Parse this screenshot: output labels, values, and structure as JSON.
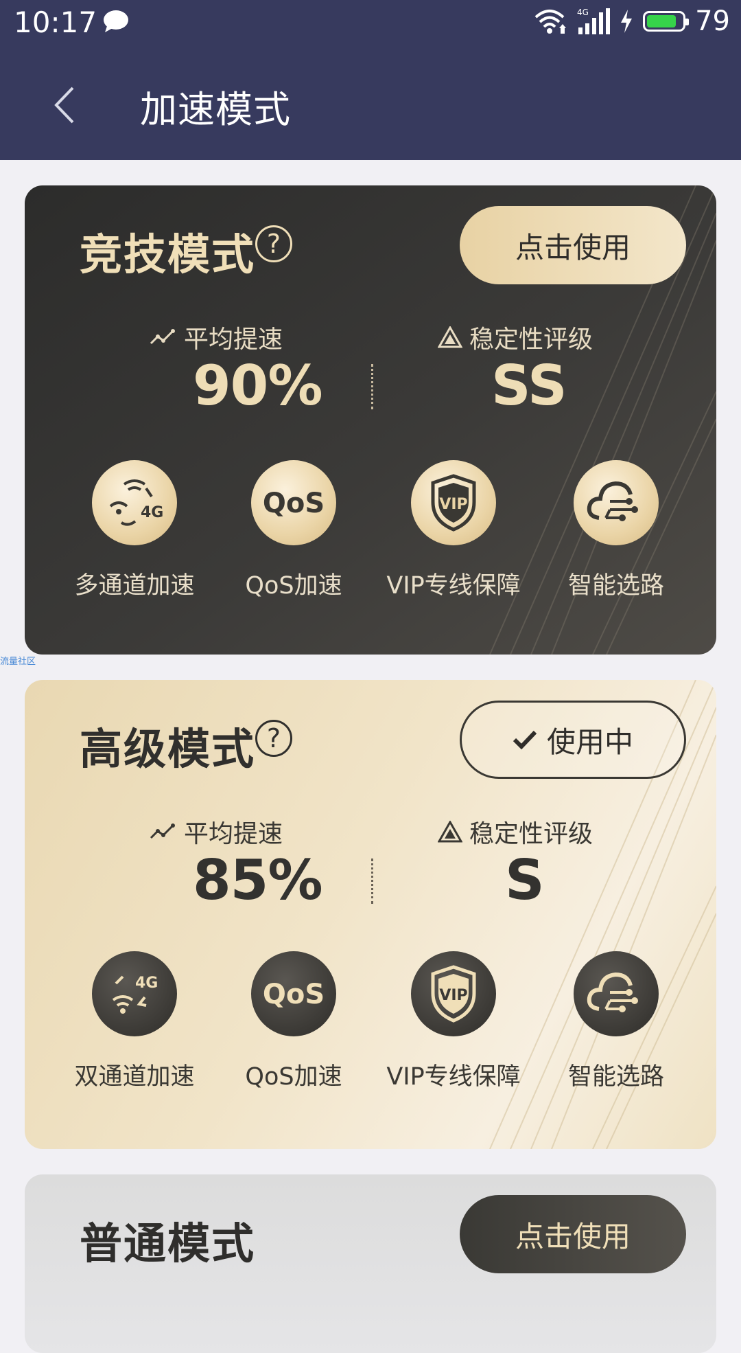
{
  "status": {
    "time": "10:17",
    "battery": "79"
  },
  "header": {
    "title": "加速模式"
  },
  "watermark": "流量社区",
  "cards": [
    {
      "title": "竞技模式",
      "action": "点击使用",
      "avg_speed_label": "平均提速",
      "avg_speed_value": "90%",
      "stability_label": "稳定性评级",
      "stability_value": "SS",
      "features": [
        "多通道加速",
        "QoS加速",
        "VIP专线保障",
        "智能选路"
      ]
    },
    {
      "title": "高级模式",
      "action": "使用中",
      "avg_speed_label": "平均提速",
      "avg_speed_value": "85%",
      "stability_label": "稳定性评级",
      "stability_value": "S",
      "features": [
        "双通道加速",
        "QoS加速",
        "VIP专线保障",
        "智能选路"
      ]
    },
    {
      "title": "普通模式",
      "action": "点击使用"
    }
  ],
  "icons": {
    "qos_text": "QoS",
    "vip_text": "VIP",
    "net_text": "4G"
  },
  "colors": {
    "header_bg": "#373a5e",
    "gold": "#eeddb6",
    "dark": "#33322f"
  }
}
